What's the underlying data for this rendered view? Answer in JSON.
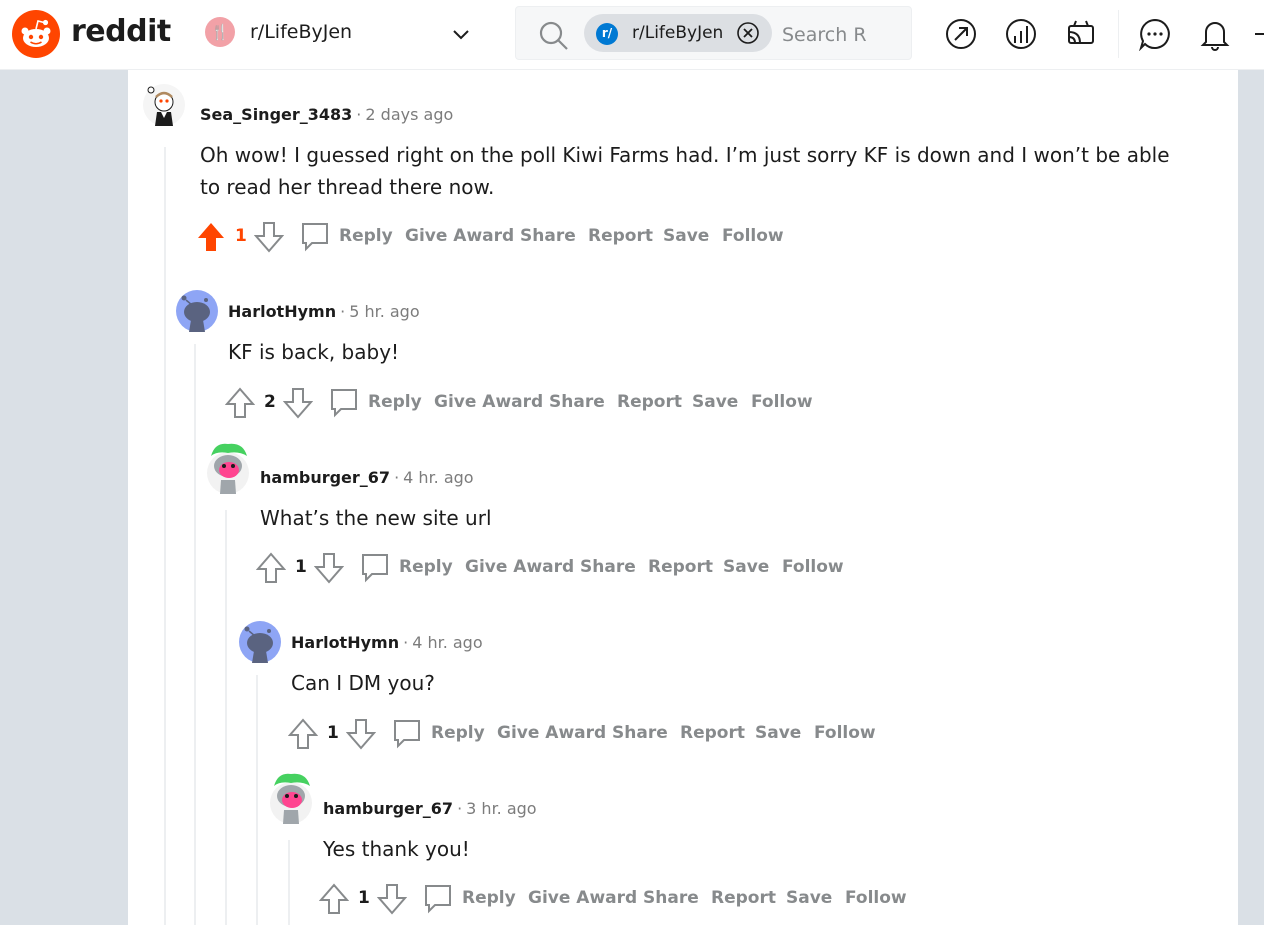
{
  "header": {
    "logo_text": "reddit",
    "community": "r/LifeByJen",
    "search": {
      "chip_label": "r/LifeByJen",
      "placeholder": "Search R"
    },
    "icons": [
      "popular-icon",
      "stats-icon",
      "community-icon",
      "chat-icon",
      "notifications-icon"
    ]
  },
  "colors": {
    "brand": "#ff4500",
    "upvoted": "#ff4500",
    "muted_text": "#878a8c",
    "chip": "#0079d3"
  },
  "comments": [
    {
      "author": "Sea_Singer_3483",
      "time": "2 days ago",
      "text_lines": [
        "Oh wow! I guessed right on the poll Kiwi Farms had. I’m just sorry KF is down and I won’t be able",
        "to read her thread there now."
      ],
      "score": "1",
      "upvoted": true,
      "avatar": "snoo-avatar-white"
    },
    {
      "author": "HarlotHymn",
      "time": "5 hr. ago",
      "text_lines": [
        "KF is back, baby!"
      ],
      "score": "2",
      "upvoted": false,
      "avatar": "default-avatar-blue"
    },
    {
      "author": "hamburger_67",
      "time": "4 hr. ago",
      "text_lines": [
        "What’s the new site url"
      ],
      "score": "1",
      "upvoted": false,
      "avatar": "snoo-avatar-green-hair"
    },
    {
      "author": "HarlotHymn",
      "time": "4 hr. ago",
      "text_lines": [
        "Can I DM you?"
      ],
      "score": "1",
      "upvoted": false,
      "avatar": "default-avatar-blue"
    },
    {
      "author": "hamburger_67",
      "time": "3 hr. ago",
      "text_lines": [
        "Yes thank you!"
      ],
      "score": "1",
      "upvoted": false,
      "avatar": "snoo-avatar-green-hair"
    }
  ],
  "actions": {
    "reply": "Reply",
    "give_award": "Give Award",
    "share": "Share",
    "report": "Report",
    "save": "Save",
    "follow": "Follow"
  }
}
